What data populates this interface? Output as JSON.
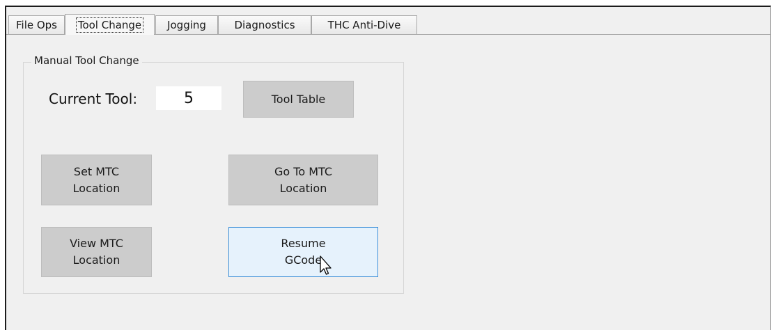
{
  "tabs": [
    {
      "label": "File Ops",
      "active": false
    },
    {
      "label": "Tool Change",
      "active": true
    },
    {
      "label": "Jogging",
      "active": false
    },
    {
      "label": "Diagnostics",
      "active": false
    },
    {
      "label": "THC Anti-Dive",
      "active": false
    }
  ],
  "manual_tool_change": {
    "group_title": "Manual Tool Change",
    "current_tool_label": "Current Tool:",
    "current_tool_value": "5",
    "tool_table_button": "Tool Table",
    "set_mtc_location_button": [
      "Set MTC",
      "Location"
    ],
    "go_to_mtc_location_button": [
      "Go To MTC",
      "Location"
    ],
    "view_mtc_location_button": [
      "View MTC",
      "Location"
    ],
    "resume_gcode_button": [
      "Resume",
      "GCode"
    ]
  },
  "colors": {
    "button_face": "#cccccc",
    "hover_button_face": "#e6f2fc",
    "hover_button_border": "#3c8fd8",
    "panel_background": "#f0f0f0"
  },
  "icons": {
    "cursor": "arrow-pointer-icon"
  }
}
